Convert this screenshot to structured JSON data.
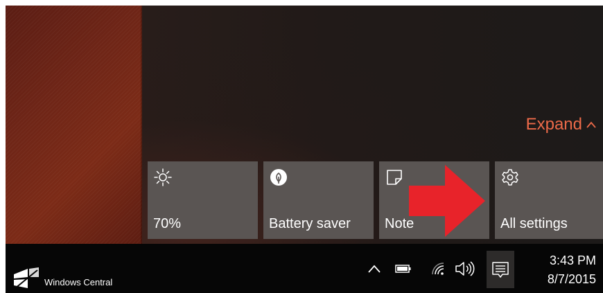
{
  "action_center": {
    "expand_label": "Expand",
    "tiles": [
      {
        "label": "70%",
        "icon": "brightness-icon"
      },
      {
        "label": "Battery saver",
        "icon": "battery-saver-icon"
      },
      {
        "label": "Note",
        "icon": "note-icon"
      },
      {
        "label": "All settings",
        "icon": "gear-icon"
      }
    ]
  },
  "taskbar": {
    "watermark": "Windows Central",
    "tray_icons": [
      "chevron-up-icon",
      "battery-icon",
      "wifi-icon",
      "volume-icon",
      "action-center-icon"
    ],
    "time": "3:43 PM",
    "date": "8/7/2015"
  },
  "colors": {
    "accent": "#ec6a49",
    "tile_bg": "#5a5553",
    "arrow": "#e8232a",
    "taskbar_bg": "#060606"
  }
}
